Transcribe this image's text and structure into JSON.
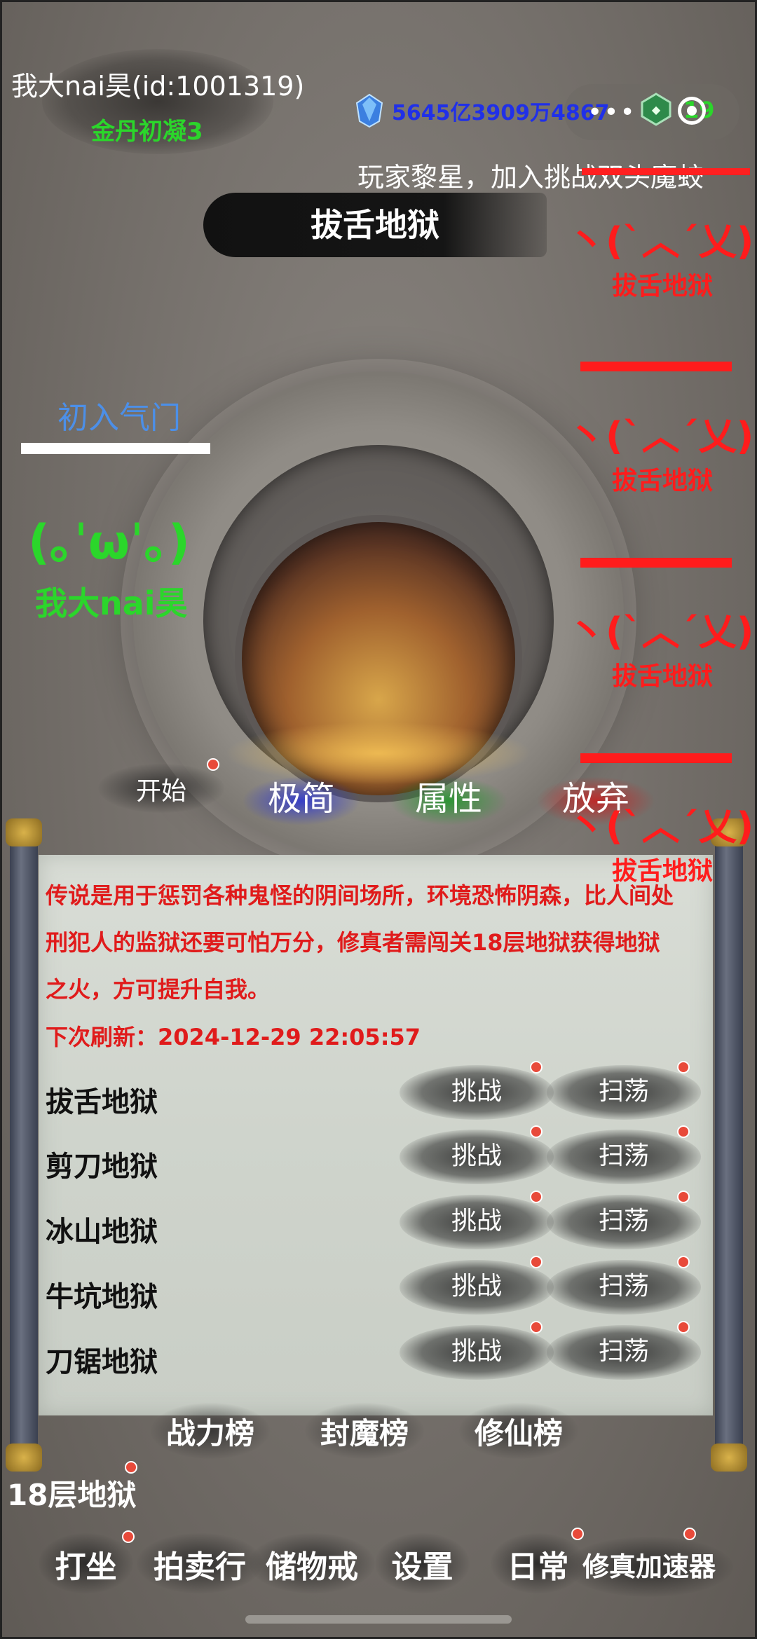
{
  "player": {
    "name_id": "我大nai昊(id:1001319)",
    "realm": "金丹初凝3",
    "currency": "5645亿3909万4867",
    "jade_count": "19",
    "display_name": "我大nai昊",
    "face": "(｡ˈωˈ｡)"
  },
  "header": {
    "more_icon": "more-dots-icon",
    "notice": "玩家黎星，加入挑战双头魔蛟",
    "title": "拔舌地狱"
  },
  "skill": {
    "label": "初入气门"
  },
  "enemies": [
    {
      "face": "丶(ˋ︿ˊ乂)ノ",
      "name": "拔舌地狱"
    },
    {
      "face": "丶(ˋ︿ˊ乂)ノ",
      "name": "拔舌地狱"
    },
    {
      "face": "丶(ˋ︿ˊ乂)ノ",
      "name": "拔舌地狱"
    },
    {
      "face": "丶(ˋ︿ˊ乂)ノ",
      "name": "拔舌地狱"
    }
  ],
  "actions": {
    "start": "开始",
    "simple": "极简",
    "attributes": "属性",
    "abandon": "放弃"
  },
  "panel": {
    "description": "传说是用于惩罚各种鬼怪的阴间场所，环境恐怖阴森，比人间处刑犯人的监狱还要可怕万分，修真者需闯关18层地狱获得地狱之火，方可提升自我。",
    "refresh": "下次刷新：2024-12-29 22:05:57",
    "rows": [
      {
        "name": "拔舌地狱",
        "challenge": "挑战",
        "sweep": "扫荡"
      },
      {
        "name": "剪刀地狱",
        "challenge": "挑战",
        "sweep": "扫荡"
      },
      {
        "name": "冰山地狱",
        "challenge": "挑战",
        "sweep": "扫荡"
      },
      {
        "name": "牛坑地狱",
        "challenge": "挑战",
        "sweep": "扫荡"
      },
      {
        "name": "刀锯地狱",
        "challenge": "挑战",
        "sweep": "扫荡"
      }
    ]
  },
  "rankings": {
    "power": "战力榜",
    "demon": "封魔榜",
    "cultivate": "修仙榜"
  },
  "hell18": "18层地狱",
  "bottom_nav": {
    "meditate": "打坐",
    "auction": "拍卖行",
    "storage": "储物戒",
    "settings": "设置",
    "daily": "日常",
    "accelerator": "修真加速器"
  },
  "colors": {
    "enemy_red": "#ff1c1c",
    "player_green": "#2bd62b",
    "currency_blue": "#2030e8",
    "skill_blue": "#4c8fe8",
    "description_red": "#e01b1b"
  }
}
